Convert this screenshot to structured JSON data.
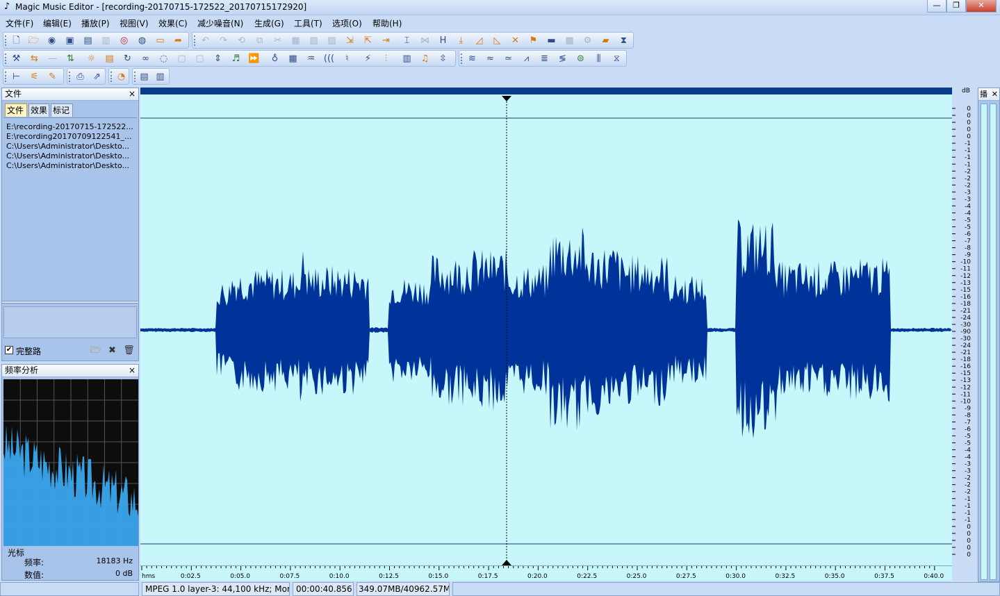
{
  "window": {
    "title": "Magic Music Editor - [recording-20170715-172522_20170715172920]",
    "minimize_glyph": "—",
    "maximize_glyph": "❐",
    "close_glyph": "✕"
  },
  "menu": [
    "文件(F)",
    "编辑(E)",
    "播放(P)",
    "视图(V)",
    "效果(C)",
    "减少噪音(N)",
    "生成(G)",
    "工具(T)",
    "选项(O)",
    "帮助(H)"
  ],
  "file_panel": {
    "title": "文件",
    "close": "×",
    "tabs": [
      "文件",
      "效果",
      "标记"
    ],
    "files": [
      "E:\\recording-20170715-172522...",
      "E:\\recording20170709122541_...",
      "C:\\Users\\Administrator\\Deskto...",
      "C:\\Users\\Administrator\\Deskto...",
      "C:\\Users\\Administrator\\Deskto..."
    ],
    "checkbox_checked": true,
    "checkbox_label": "完整路"
  },
  "freq_panel": {
    "title": "频率分析",
    "close": "×",
    "cursor_label": "光标",
    "freq_label": "频率:",
    "freq_value": "18183 Hz",
    "value_label": "数值:",
    "value_value": "0 dB"
  },
  "db_scale": {
    "unit": "dB",
    "labels": [
      "0",
      "0",
      "0",
      "0",
      "0",
      "-1",
      "-1",
      "-1",
      "-1",
      "-2",
      "-2",
      "-2",
      "-3",
      "-3",
      "-4",
      "-4",
      "-5",
      "-5",
      "-6",
      "-7",
      "-8",
      "-9",
      "-10",
      "-11",
      "-12",
      "-13",
      "-15",
      "-16",
      "-18",
      "-21",
      "-24",
      "-30",
      "-90",
      "-30",
      "-24",
      "-21",
      "-18",
      "-16",
      "-15",
      "-13",
      "-12",
      "-11",
      "-10",
      "-9",
      "-8",
      "-7",
      "-6",
      "-5",
      "-5",
      "-4",
      "-4",
      "-3",
      "-3",
      "-2",
      "-2",
      "-2",
      "-1",
      "-1",
      "-1",
      "-1",
      "0",
      "0",
      "0",
      "0",
      "0"
    ]
  },
  "timeline": {
    "labels": [
      "hms",
      "0:02.5",
      "0:05.0",
      "0:07.5",
      "0:10.0",
      "0:12.5",
      "0:15.0",
      "0:17.5",
      "0:20.0",
      "0:22.5",
      "0:25.0",
      "0:27.5",
      "0:30.0",
      "0:32.5",
      "0:35.0",
      "0:37.5",
      "0:40.0"
    ]
  },
  "meter_panel": {
    "title": "播",
    "close": "✕"
  },
  "status": {
    "format": "MPEG 1.0 layer-3: 44,100 kHz; Mor",
    "position": "00:00:40.856",
    "memory": "349.07MB/40962.57M"
  },
  "colors": {
    "wave": "#003399",
    "wave_bg": "#c8f7fb",
    "spectrum_bg": "#0d0d0d",
    "spectrum": "#3aa6ee"
  }
}
